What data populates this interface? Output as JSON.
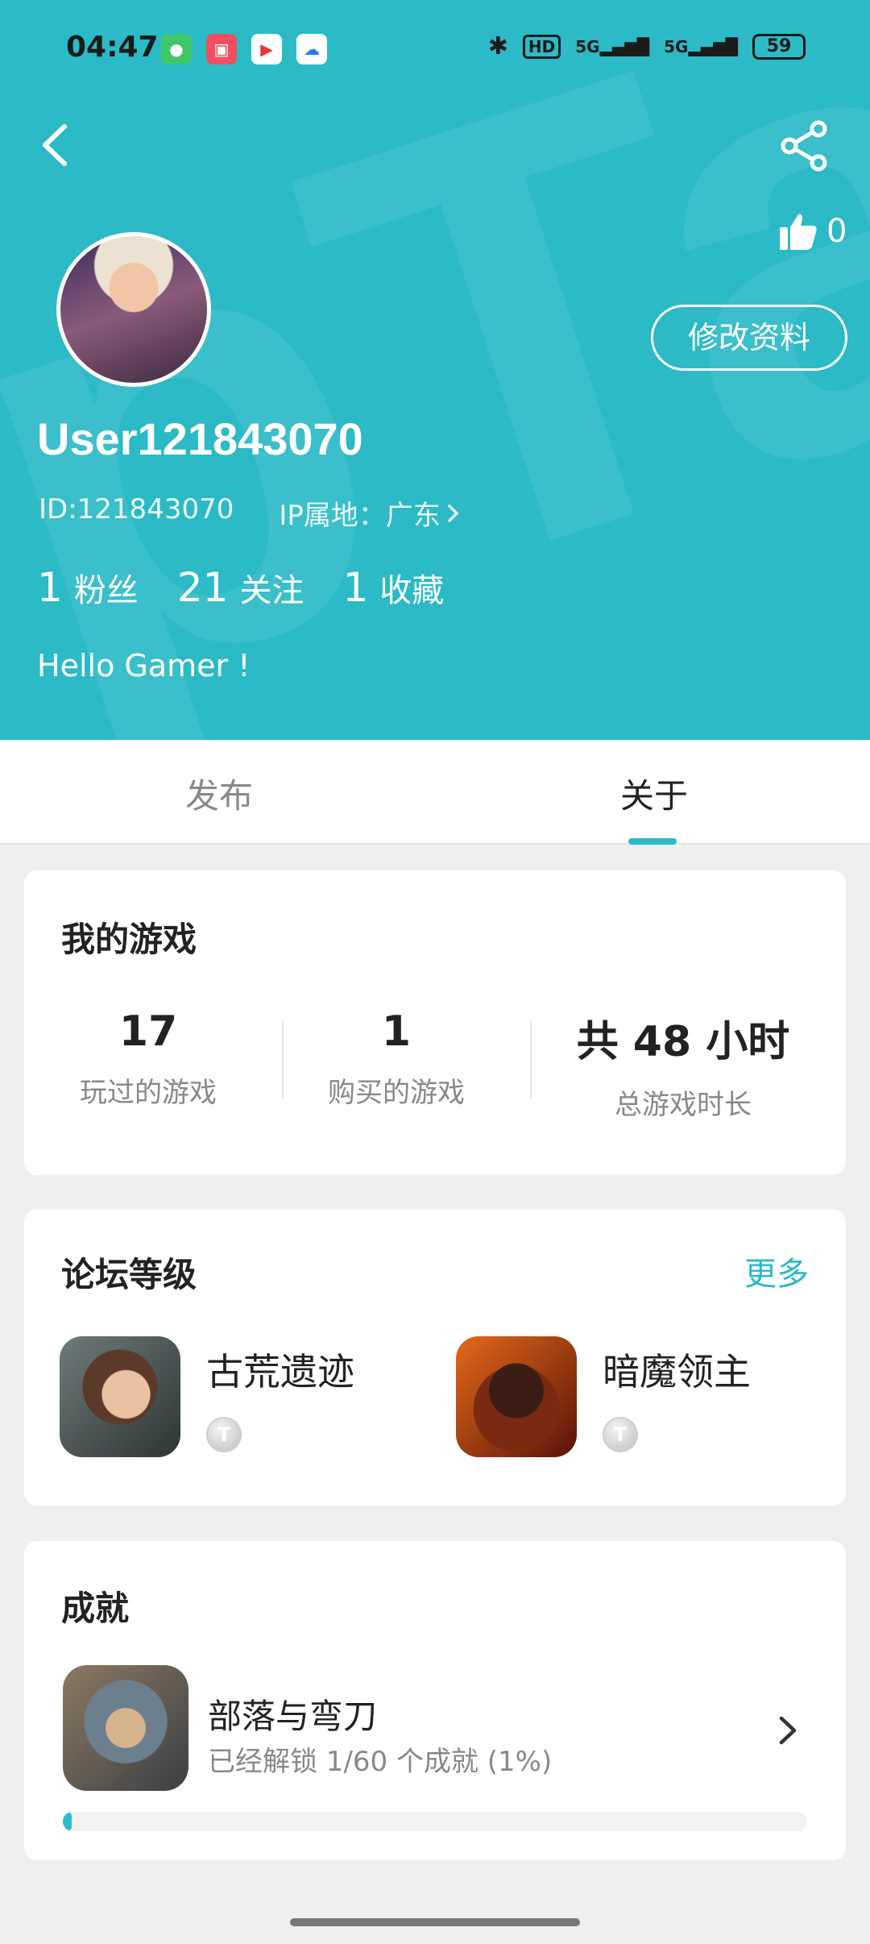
{
  "status_bar": {
    "time": "04:47",
    "notification_icons": [
      "messages-icon",
      "video-icon",
      "play-icon",
      "cloud-icon"
    ],
    "hd_label": "HD",
    "signal_1": "5G",
    "signal_2": "5G",
    "battery": "59"
  },
  "colors": {
    "accent": "#2bbac6",
    "header_bg": "#2bbac6"
  },
  "profile": {
    "like_count": "0",
    "edit_label": "修改资料",
    "username": "User121843070",
    "id_text": "ID:121843070",
    "ip_text": "IP属地：广东",
    "stats": [
      {
        "value": "1",
        "label": "粉丝"
      },
      {
        "value": "21",
        "label": "关注"
      },
      {
        "value": "1",
        "label": "收藏"
      }
    ],
    "bio": "Hello Gamer !"
  },
  "tabs": [
    {
      "label": "发布"
    },
    {
      "label": "关于"
    }
  ],
  "my_games": {
    "title": "我的游戏",
    "stats": [
      {
        "value": "17",
        "label": "玩过的游戏"
      },
      {
        "value": "1",
        "label": "购买的游戏"
      },
      {
        "value": "共 48 小时",
        "label": "总游戏时长"
      }
    ]
  },
  "forum_level": {
    "title": "论坛等级",
    "more_label": "更多",
    "items": [
      {
        "name": "古荒遗迹",
        "badge": "T"
      },
      {
        "name": "暗魔领主",
        "badge": "T"
      }
    ]
  },
  "achievements": {
    "title": "成就",
    "game": "部落与弯刀",
    "desc": "已经解锁 1/60 个成就 (1%)",
    "progress_fraction": 0.01
  }
}
